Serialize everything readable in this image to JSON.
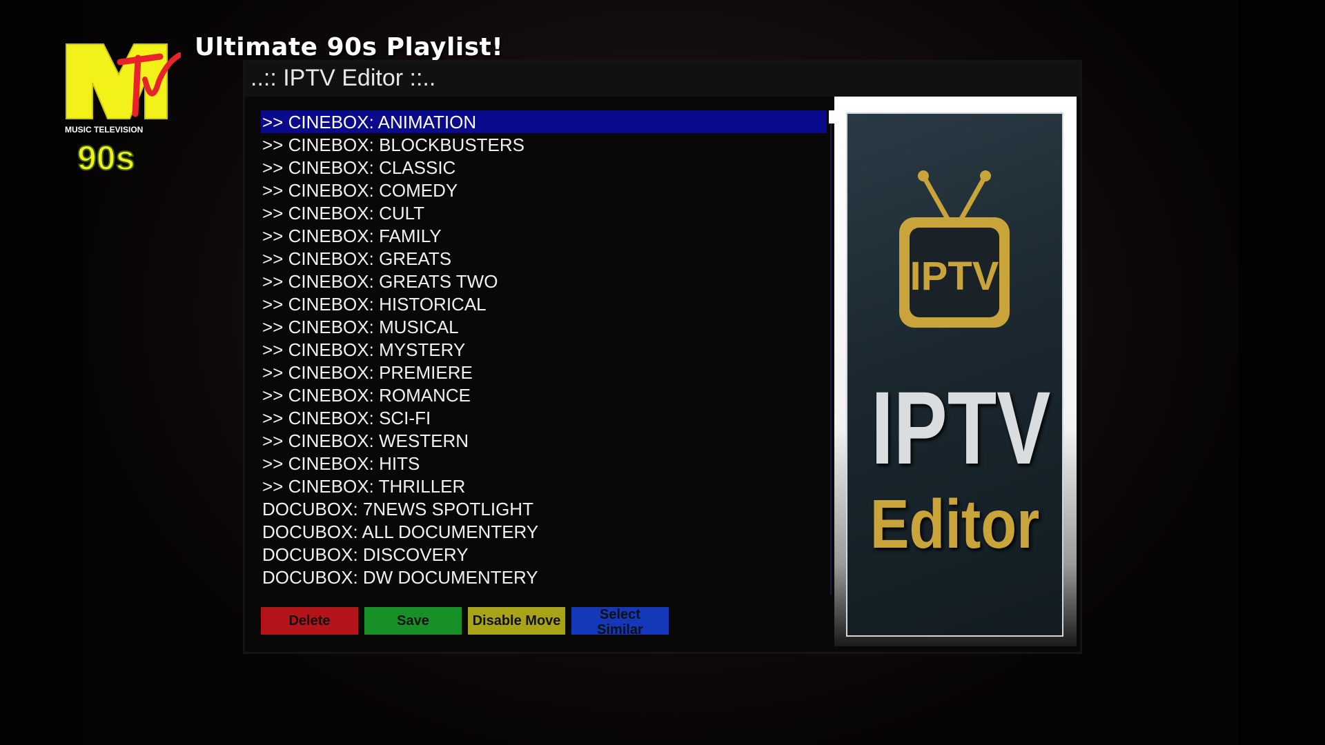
{
  "header": {
    "app_title": "Ultimate 90s Playlist!",
    "logo_text": "MTV",
    "logo_subtitle": "MUSIC TELEVISION",
    "logo_decade": "90s"
  },
  "dialog": {
    "title": "..:: IPTV Editor ::..",
    "selected_index": 0,
    "items": [
      ">> CINEBOX: ANIMATION",
      ">> CINEBOX: BLOCKBUSTERS",
      ">> CINEBOX: CLASSIC",
      ">> CINEBOX: COMEDY",
      ">> CINEBOX: CULT",
      ">> CINEBOX: FAMILY",
      ">> CINEBOX: GREATS",
      ">> CINEBOX: GREATS TWO",
      ">> CINEBOX: HISTORICAL",
      ">> CINEBOX: MUSICAL",
      ">> CINEBOX: MYSTERY",
      ">> CINEBOX: PREMIERE",
      ">> CINEBOX: ROMANCE",
      ">> CINEBOX: SCI-FI",
      ">> CINEBOX: WESTERN",
      ">> CINEBOX: HITS",
      ">> CINEBOX: THRILLER",
      "DOCUBOX: 7NEWS SPOTLIGHT",
      "DOCUBOX: ALL DOCUMENTERY",
      "DOCUBOX: DISCOVERY",
      "DOCUBOX: DW DOCUMENTERY"
    ],
    "buttons": {
      "delete": "Delete",
      "save": "Save",
      "disable_move": "Disable Move",
      "select_similar": "Select Similar"
    },
    "poster": {
      "icon_text": "IPTV",
      "big_text": "IPTV",
      "sub_text": "Editor"
    }
  },
  "colors": {
    "selection": "#0a0a8c",
    "delete": "#b3141a",
    "save": "#189028",
    "disable_move": "#a8a418",
    "select_similar": "#1438b8",
    "logo_yellow": "#f2f21a",
    "poster_gold": "#c9a43a"
  }
}
